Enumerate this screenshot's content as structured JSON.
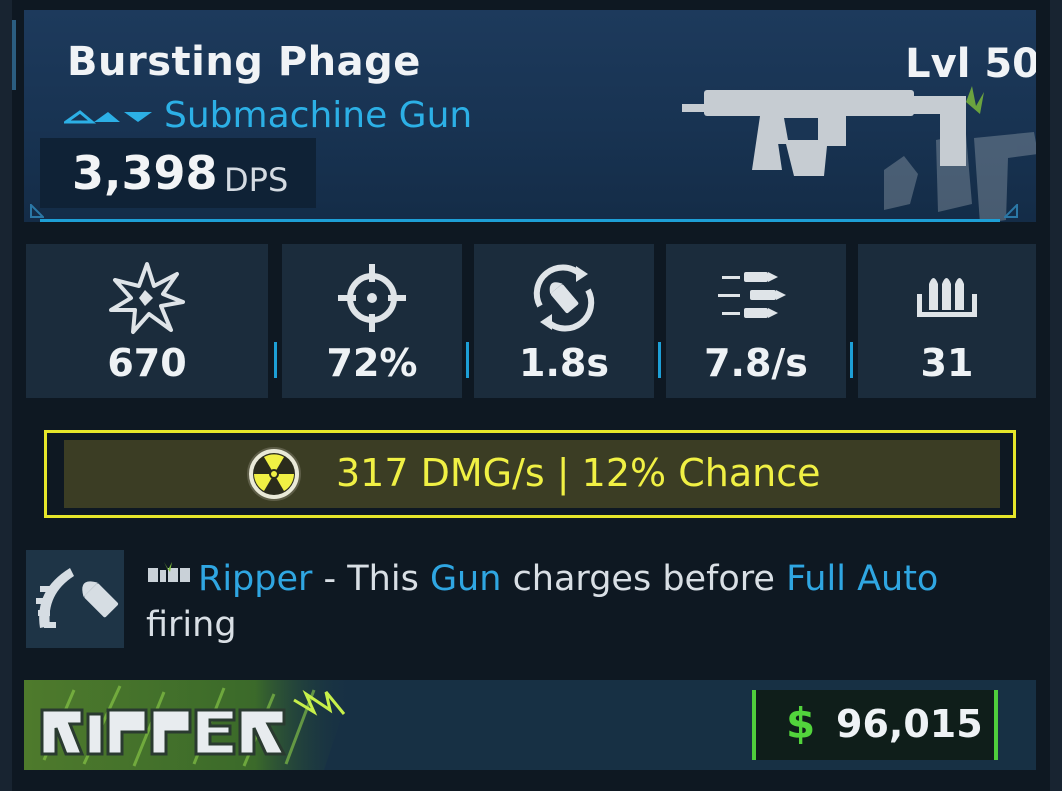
{
  "weapon": {
    "name": "Bursting Phage",
    "level": "Lvl 50",
    "type": "Submachine Gun",
    "dps_value": "3,398",
    "dps_unit": "DPS"
  },
  "stats": [
    {
      "icon": "burst-damage-icon",
      "value": "670"
    },
    {
      "icon": "crosshair-accuracy-icon",
      "value": "72%"
    },
    {
      "icon": "reload-icon",
      "value": "1.8s"
    },
    {
      "icon": "fire-rate-icon",
      "value": "7.8/s"
    },
    {
      "icon": "magazine-icon",
      "value": "31"
    }
  ],
  "element": {
    "icon": "radiation-icon",
    "text": "317 DMG/s | 12% Chance",
    "color": "#f0f044"
  },
  "perk": {
    "icon": "charge-shot-icon",
    "maker_icon": "ripper-logo-icon",
    "line1": {
      "name": "Ripper",
      "sep": " - This ",
      "kw1": "Gun",
      "mid": " charges before ",
      "kw2": "Full Auto"
    },
    "line2": "firing"
  },
  "footer": {
    "manufacturer_logo_text": "RIPPER",
    "price_icon": "dollar-icon",
    "price_symbol": "$",
    "price": "96,015"
  },
  "colors": {
    "accent_blue": "#2cb0e6",
    "element_yellow": "#e6e62a",
    "price_green": "#4fce3c"
  }
}
